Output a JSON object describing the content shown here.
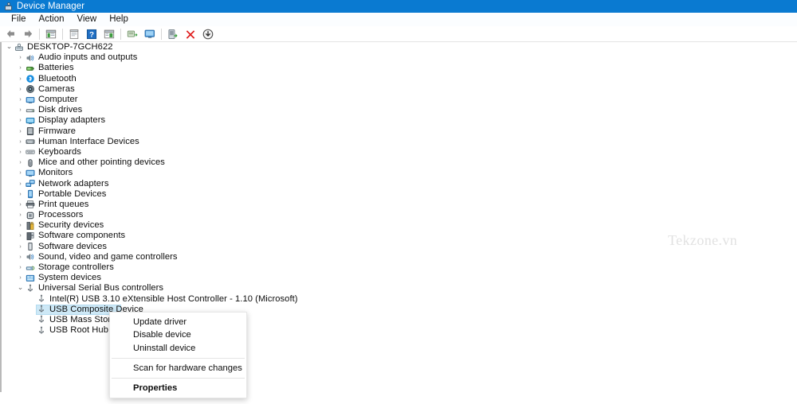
{
  "window": {
    "title": "Device Manager",
    "title_icon": "device-manager-icon",
    "titlebar_color": "#0a7ad1"
  },
  "menubar": {
    "items": [
      {
        "label": "File"
      },
      {
        "label": "Action"
      },
      {
        "label": "View"
      },
      {
        "label": "Help"
      }
    ]
  },
  "toolbar": {
    "buttons": [
      {
        "icon": "back-arrow-icon",
        "tooltip": "Back"
      },
      {
        "icon": "forward-arrow-icon",
        "tooltip": "Forward"
      },
      {
        "sep": true
      },
      {
        "icon": "show-hide-console-tree-icon",
        "tooltip": "Show/Hide Console Tree"
      },
      {
        "sep": true
      },
      {
        "icon": "properties-icon",
        "tooltip": "Properties"
      },
      {
        "icon": "help-icon",
        "tooltip": "Help"
      },
      {
        "icon": "view-window-icon",
        "tooltip": "View"
      },
      {
        "sep": true
      },
      {
        "icon": "scan-for-hardware-changes-icon",
        "tooltip": "Scan for hardware changes"
      },
      {
        "icon": "monitor-icon",
        "tooltip": "Display"
      },
      {
        "sep": true
      },
      {
        "icon": "update-driver-icon",
        "tooltip": "Update driver"
      },
      {
        "icon": "uninstall-device-icon",
        "tooltip": "Uninstall device"
      },
      {
        "icon": "disable-device-icon",
        "tooltip": "Disable device"
      }
    ]
  },
  "tree": {
    "nodes": [
      {
        "label": "DESKTOP-7GCH622",
        "level": 0,
        "chevron": "expanded",
        "icon": "computer-root-icon",
        "selected": false
      },
      {
        "label": "Audio inputs and outputs",
        "level": 1,
        "chevron": "collapsed",
        "icon": "speaker-icon",
        "selected": false
      },
      {
        "label": "Batteries",
        "level": 1,
        "chevron": "collapsed",
        "icon": "battery-icon",
        "selected": false
      },
      {
        "label": "Bluetooth",
        "level": 1,
        "chevron": "collapsed",
        "icon": "bluetooth-icon",
        "selected": false
      },
      {
        "label": "Cameras",
        "level": 1,
        "chevron": "collapsed",
        "icon": "camera-icon",
        "selected": false
      },
      {
        "label": "Computer",
        "level": 1,
        "chevron": "collapsed",
        "icon": "computer-icon",
        "selected": false
      },
      {
        "label": "Disk drives",
        "level": 1,
        "chevron": "collapsed",
        "icon": "disk-drive-icon",
        "selected": false
      },
      {
        "label": "Display adapters",
        "level": 1,
        "chevron": "collapsed",
        "icon": "display-adapter-icon",
        "selected": false
      },
      {
        "label": "Firmware",
        "level": 1,
        "chevron": "collapsed",
        "icon": "firmware-icon",
        "selected": false
      },
      {
        "label": "Human Interface Devices",
        "level": 1,
        "chevron": "collapsed",
        "icon": "hid-icon",
        "selected": false
      },
      {
        "label": "Keyboards",
        "level": 1,
        "chevron": "collapsed",
        "icon": "keyboard-icon",
        "selected": false
      },
      {
        "label": "Mice and other pointing devices",
        "level": 1,
        "chevron": "collapsed",
        "icon": "mouse-icon",
        "selected": false
      },
      {
        "label": "Monitors",
        "level": 1,
        "chevron": "collapsed",
        "icon": "monitor-icon",
        "selected": false
      },
      {
        "label": "Network adapters",
        "level": 1,
        "chevron": "collapsed",
        "icon": "network-adapter-icon",
        "selected": false
      },
      {
        "label": "Portable Devices",
        "level": 1,
        "chevron": "collapsed",
        "icon": "portable-device-icon",
        "selected": false
      },
      {
        "label": "Print queues",
        "level": 1,
        "chevron": "collapsed",
        "icon": "printer-icon",
        "selected": false
      },
      {
        "label": "Processors",
        "level": 1,
        "chevron": "collapsed",
        "icon": "processor-icon",
        "selected": false
      },
      {
        "label": "Security devices",
        "level": 1,
        "chevron": "collapsed",
        "icon": "security-device-icon",
        "selected": false
      },
      {
        "label": "Software components",
        "level": 1,
        "chevron": "collapsed",
        "icon": "software-component-icon",
        "selected": false
      },
      {
        "label": "Software devices",
        "level": 1,
        "chevron": "collapsed",
        "icon": "software-device-icon",
        "selected": false
      },
      {
        "label": "Sound, video and game controllers",
        "level": 1,
        "chevron": "collapsed",
        "icon": "sound-controller-icon",
        "selected": false
      },
      {
        "label": "Storage controllers",
        "level": 1,
        "chevron": "collapsed",
        "icon": "storage-controller-icon",
        "selected": false
      },
      {
        "label": "System devices",
        "level": 1,
        "chevron": "collapsed",
        "icon": "system-device-icon",
        "selected": false
      },
      {
        "label": "Universal Serial Bus controllers",
        "level": 1,
        "chevron": "expanded",
        "icon": "usb-icon",
        "selected": false
      },
      {
        "label": "Intel(R) USB 3.10 eXtensible Host Controller - 1.10 (Microsoft)",
        "level": 2,
        "chevron": "none",
        "icon": "usb-icon",
        "selected": false
      },
      {
        "label": "USB Composite Device",
        "level": 2,
        "chevron": "none",
        "icon": "usb-icon",
        "selected": true
      },
      {
        "label": "USB Mass Storage D",
        "level": 2,
        "chevron": "none",
        "icon": "usb-icon",
        "selected": false
      },
      {
        "label": "USB Root Hub (USB",
        "level": 2,
        "chevron": "none",
        "icon": "usb-icon",
        "selected": false
      }
    ]
  },
  "context_menu": {
    "items": [
      {
        "label": "Update driver",
        "type": "item",
        "bold": false
      },
      {
        "label": "Disable device",
        "type": "item",
        "bold": false
      },
      {
        "label": "Uninstall device",
        "type": "item",
        "bold": false
      },
      {
        "label": "",
        "type": "separator",
        "bold": false
      },
      {
        "label": "Scan for hardware changes",
        "type": "item",
        "bold": false
      },
      {
        "label": "",
        "type": "separator",
        "bold": false
      },
      {
        "label": "Properties",
        "type": "item",
        "bold": true
      }
    ]
  },
  "watermark": {
    "text": "Tekzone.vn",
    "color": "#e2e2e2"
  }
}
